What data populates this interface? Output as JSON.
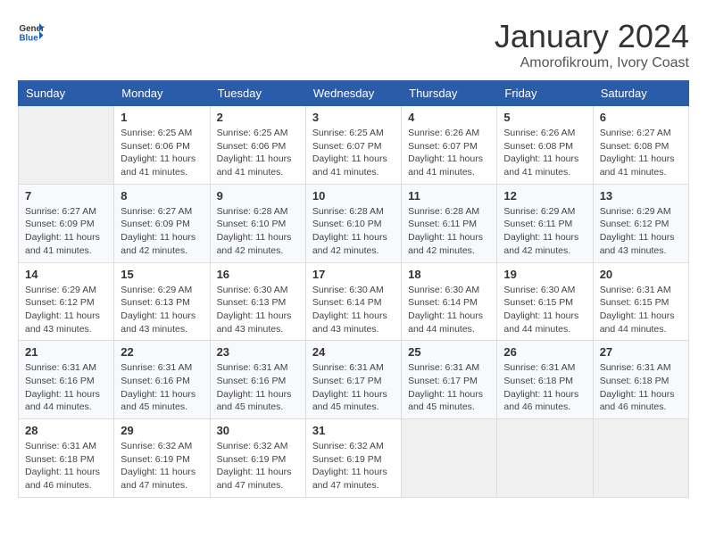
{
  "logo": {
    "line1": "General",
    "line2": "Blue"
  },
  "title": "January 2024",
  "subtitle": "Amorofikroum, Ivory Coast",
  "days_of_week": [
    "Sunday",
    "Monday",
    "Tuesday",
    "Wednesday",
    "Thursday",
    "Friday",
    "Saturday"
  ],
  "weeks": [
    [
      {
        "day": "",
        "info": ""
      },
      {
        "day": "1",
        "info": "Sunrise: 6:25 AM\nSunset: 6:06 PM\nDaylight: 11 hours\nand 41 minutes."
      },
      {
        "day": "2",
        "info": "Sunrise: 6:25 AM\nSunset: 6:06 PM\nDaylight: 11 hours\nand 41 minutes."
      },
      {
        "day": "3",
        "info": "Sunrise: 6:25 AM\nSunset: 6:07 PM\nDaylight: 11 hours\nand 41 minutes."
      },
      {
        "day": "4",
        "info": "Sunrise: 6:26 AM\nSunset: 6:07 PM\nDaylight: 11 hours\nand 41 minutes."
      },
      {
        "day": "5",
        "info": "Sunrise: 6:26 AM\nSunset: 6:08 PM\nDaylight: 11 hours\nand 41 minutes."
      },
      {
        "day": "6",
        "info": "Sunrise: 6:27 AM\nSunset: 6:08 PM\nDaylight: 11 hours\nand 41 minutes."
      }
    ],
    [
      {
        "day": "7",
        "info": "Sunrise: 6:27 AM\nSunset: 6:09 PM\nDaylight: 11 hours\nand 41 minutes."
      },
      {
        "day": "8",
        "info": "Sunrise: 6:27 AM\nSunset: 6:09 PM\nDaylight: 11 hours\nand 42 minutes."
      },
      {
        "day": "9",
        "info": "Sunrise: 6:28 AM\nSunset: 6:10 PM\nDaylight: 11 hours\nand 42 minutes."
      },
      {
        "day": "10",
        "info": "Sunrise: 6:28 AM\nSunset: 6:10 PM\nDaylight: 11 hours\nand 42 minutes."
      },
      {
        "day": "11",
        "info": "Sunrise: 6:28 AM\nSunset: 6:11 PM\nDaylight: 11 hours\nand 42 minutes."
      },
      {
        "day": "12",
        "info": "Sunrise: 6:29 AM\nSunset: 6:11 PM\nDaylight: 11 hours\nand 42 minutes."
      },
      {
        "day": "13",
        "info": "Sunrise: 6:29 AM\nSunset: 6:12 PM\nDaylight: 11 hours\nand 43 minutes."
      }
    ],
    [
      {
        "day": "14",
        "info": "Sunrise: 6:29 AM\nSunset: 6:12 PM\nDaylight: 11 hours\nand 43 minutes."
      },
      {
        "day": "15",
        "info": "Sunrise: 6:29 AM\nSunset: 6:13 PM\nDaylight: 11 hours\nand 43 minutes."
      },
      {
        "day": "16",
        "info": "Sunrise: 6:30 AM\nSunset: 6:13 PM\nDaylight: 11 hours\nand 43 minutes."
      },
      {
        "day": "17",
        "info": "Sunrise: 6:30 AM\nSunset: 6:14 PM\nDaylight: 11 hours\nand 43 minutes."
      },
      {
        "day": "18",
        "info": "Sunrise: 6:30 AM\nSunset: 6:14 PM\nDaylight: 11 hours\nand 44 minutes."
      },
      {
        "day": "19",
        "info": "Sunrise: 6:30 AM\nSunset: 6:15 PM\nDaylight: 11 hours\nand 44 minutes."
      },
      {
        "day": "20",
        "info": "Sunrise: 6:31 AM\nSunset: 6:15 PM\nDaylight: 11 hours\nand 44 minutes."
      }
    ],
    [
      {
        "day": "21",
        "info": "Sunrise: 6:31 AM\nSunset: 6:16 PM\nDaylight: 11 hours\nand 44 minutes."
      },
      {
        "day": "22",
        "info": "Sunrise: 6:31 AM\nSunset: 6:16 PM\nDaylight: 11 hours\nand 45 minutes."
      },
      {
        "day": "23",
        "info": "Sunrise: 6:31 AM\nSunset: 6:16 PM\nDaylight: 11 hours\nand 45 minutes."
      },
      {
        "day": "24",
        "info": "Sunrise: 6:31 AM\nSunset: 6:17 PM\nDaylight: 11 hours\nand 45 minutes."
      },
      {
        "day": "25",
        "info": "Sunrise: 6:31 AM\nSunset: 6:17 PM\nDaylight: 11 hours\nand 45 minutes."
      },
      {
        "day": "26",
        "info": "Sunrise: 6:31 AM\nSunset: 6:18 PM\nDaylight: 11 hours\nand 46 minutes."
      },
      {
        "day": "27",
        "info": "Sunrise: 6:31 AM\nSunset: 6:18 PM\nDaylight: 11 hours\nand 46 minutes."
      }
    ],
    [
      {
        "day": "28",
        "info": "Sunrise: 6:31 AM\nSunset: 6:18 PM\nDaylight: 11 hours\nand 46 minutes."
      },
      {
        "day": "29",
        "info": "Sunrise: 6:32 AM\nSunset: 6:19 PM\nDaylight: 11 hours\nand 47 minutes."
      },
      {
        "day": "30",
        "info": "Sunrise: 6:32 AM\nSunset: 6:19 PM\nDaylight: 11 hours\nand 47 minutes."
      },
      {
        "day": "31",
        "info": "Sunrise: 6:32 AM\nSunset: 6:19 PM\nDaylight: 11 hours\nand 47 minutes."
      },
      {
        "day": "",
        "info": ""
      },
      {
        "day": "",
        "info": ""
      },
      {
        "day": "",
        "info": ""
      }
    ]
  ]
}
